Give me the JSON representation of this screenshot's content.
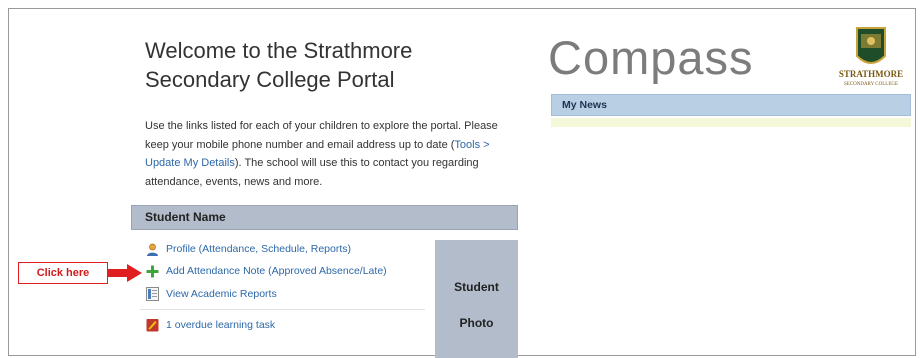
{
  "welcome": {
    "title_line1": "Welcome to the Strathmore",
    "title_line2": "Secondary College Portal",
    "intro": "Use the links listed for each of your children to explore the portal. Please keep your mobile phone number and email address up to date (",
    "link_text": "Tools > Update My Details",
    "outro": "). The school will use this to contact you regarding attendance, events, news and more."
  },
  "student": {
    "header": "Student Name",
    "links": [
      {
        "label": "Profile (Attendance, Schedule, Reports)",
        "icon": "person-icon"
      },
      {
        "label": "Add Attendance Note (Approved Absence/Late)",
        "icon": "plus-icon"
      },
      {
        "label": "View Academic Reports",
        "icon": "report-icon"
      },
      {
        "label": "1 overdue learning task",
        "icon": "task-icon"
      }
    ],
    "photo_line1": "Student",
    "photo_line2": "Photo"
  },
  "callout": {
    "label": "Click here",
    "color": "#e02020"
  },
  "brand": {
    "logo": "Compass",
    "crest_text1": "STRATHMORE",
    "crest_text2": "SECONDARY COLLEGE"
  },
  "news": {
    "header": "My News"
  },
  "colors": {
    "link": "#2d68a8",
    "header_bg": "#b3bccb",
    "news_bg": "#b8cfe4",
    "plus_green": "#3fa53a"
  }
}
